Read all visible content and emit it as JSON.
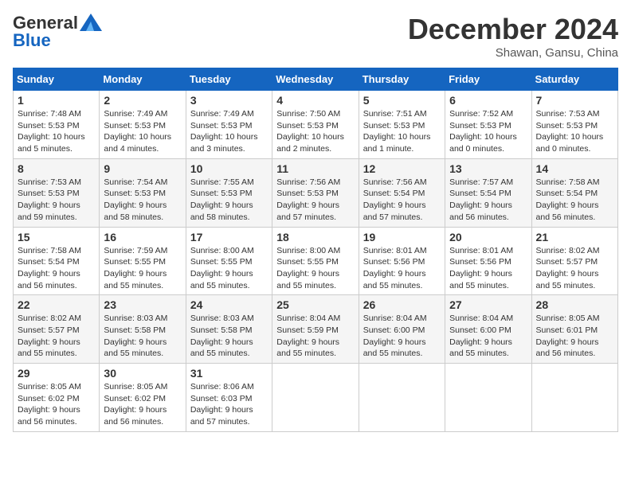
{
  "header": {
    "logo_general": "General",
    "logo_blue": "Blue",
    "month": "December 2024",
    "location": "Shawan, Gansu, China"
  },
  "weekdays": [
    "Sunday",
    "Monday",
    "Tuesday",
    "Wednesday",
    "Thursday",
    "Friday",
    "Saturday"
  ],
  "weeks": [
    [
      {
        "day": "1",
        "sunrise": "7:48 AM",
        "sunset": "5:53 PM",
        "daylight": "10 hours and 5 minutes."
      },
      {
        "day": "2",
        "sunrise": "7:49 AM",
        "sunset": "5:53 PM",
        "daylight": "10 hours and 4 minutes."
      },
      {
        "day": "3",
        "sunrise": "7:49 AM",
        "sunset": "5:53 PM",
        "daylight": "10 hours and 3 minutes."
      },
      {
        "day": "4",
        "sunrise": "7:50 AM",
        "sunset": "5:53 PM",
        "daylight": "10 hours and 2 minutes."
      },
      {
        "day": "5",
        "sunrise": "7:51 AM",
        "sunset": "5:53 PM",
        "daylight": "10 hours and 1 minute."
      },
      {
        "day": "6",
        "sunrise": "7:52 AM",
        "sunset": "5:53 PM",
        "daylight": "10 hours and 0 minutes."
      },
      {
        "day": "7",
        "sunrise": "7:53 AM",
        "sunset": "5:53 PM",
        "daylight": "10 hours and 0 minutes."
      }
    ],
    [
      {
        "day": "8",
        "sunrise": "7:53 AM",
        "sunset": "5:53 PM",
        "daylight": "9 hours and 59 minutes."
      },
      {
        "day": "9",
        "sunrise": "7:54 AM",
        "sunset": "5:53 PM",
        "daylight": "9 hours and 58 minutes."
      },
      {
        "day": "10",
        "sunrise": "7:55 AM",
        "sunset": "5:53 PM",
        "daylight": "9 hours and 58 minutes."
      },
      {
        "day": "11",
        "sunrise": "7:56 AM",
        "sunset": "5:53 PM",
        "daylight": "9 hours and 57 minutes."
      },
      {
        "day": "12",
        "sunrise": "7:56 AM",
        "sunset": "5:54 PM",
        "daylight": "9 hours and 57 minutes."
      },
      {
        "day": "13",
        "sunrise": "7:57 AM",
        "sunset": "5:54 PM",
        "daylight": "9 hours and 56 minutes."
      },
      {
        "day": "14",
        "sunrise": "7:58 AM",
        "sunset": "5:54 PM",
        "daylight": "9 hours and 56 minutes."
      }
    ],
    [
      {
        "day": "15",
        "sunrise": "7:58 AM",
        "sunset": "5:54 PM",
        "daylight": "9 hours and 56 minutes."
      },
      {
        "day": "16",
        "sunrise": "7:59 AM",
        "sunset": "5:55 PM",
        "daylight": "9 hours and 55 minutes."
      },
      {
        "day": "17",
        "sunrise": "8:00 AM",
        "sunset": "5:55 PM",
        "daylight": "9 hours and 55 minutes."
      },
      {
        "day": "18",
        "sunrise": "8:00 AM",
        "sunset": "5:55 PM",
        "daylight": "9 hours and 55 minutes."
      },
      {
        "day": "19",
        "sunrise": "8:01 AM",
        "sunset": "5:56 PM",
        "daylight": "9 hours and 55 minutes."
      },
      {
        "day": "20",
        "sunrise": "8:01 AM",
        "sunset": "5:56 PM",
        "daylight": "9 hours and 55 minutes."
      },
      {
        "day": "21",
        "sunrise": "8:02 AM",
        "sunset": "5:57 PM",
        "daylight": "9 hours and 55 minutes."
      }
    ],
    [
      {
        "day": "22",
        "sunrise": "8:02 AM",
        "sunset": "5:57 PM",
        "daylight": "9 hours and 55 minutes."
      },
      {
        "day": "23",
        "sunrise": "8:03 AM",
        "sunset": "5:58 PM",
        "daylight": "9 hours and 55 minutes."
      },
      {
        "day": "24",
        "sunrise": "8:03 AM",
        "sunset": "5:58 PM",
        "daylight": "9 hours and 55 minutes."
      },
      {
        "day": "25",
        "sunrise": "8:04 AM",
        "sunset": "5:59 PM",
        "daylight": "9 hours and 55 minutes."
      },
      {
        "day": "26",
        "sunrise": "8:04 AM",
        "sunset": "6:00 PM",
        "daylight": "9 hours and 55 minutes."
      },
      {
        "day": "27",
        "sunrise": "8:04 AM",
        "sunset": "6:00 PM",
        "daylight": "9 hours and 55 minutes."
      },
      {
        "day": "28",
        "sunrise": "8:05 AM",
        "sunset": "6:01 PM",
        "daylight": "9 hours and 56 minutes."
      }
    ],
    [
      {
        "day": "29",
        "sunrise": "8:05 AM",
        "sunset": "6:02 PM",
        "daylight": "9 hours and 56 minutes."
      },
      {
        "day": "30",
        "sunrise": "8:05 AM",
        "sunset": "6:02 PM",
        "daylight": "9 hours and 56 minutes."
      },
      {
        "day": "31",
        "sunrise": "8:06 AM",
        "sunset": "6:03 PM",
        "daylight": "9 hours and 57 minutes."
      },
      null,
      null,
      null,
      null
    ]
  ]
}
